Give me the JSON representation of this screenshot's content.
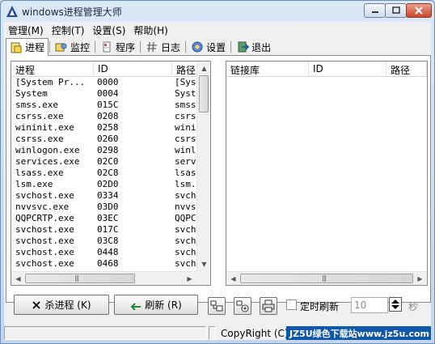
{
  "window": {
    "title": "windows进程管理大师"
  },
  "menu": [
    "管理(M)",
    "控制(T)",
    "设置(S)",
    "帮助(H)"
  ],
  "tabs": [
    {
      "label": "进程",
      "icon": "process-icon",
      "active": true
    },
    {
      "label": "监控",
      "icon": "monitor-icon",
      "active": false
    },
    {
      "label": "程序",
      "icon": "program-icon",
      "active": false
    },
    {
      "label": "日志",
      "icon": "log-icon",
      "active": false
    },
    {
      "label": "设置",
      "icon": "settings-icon",
      "active": false
    },
    {
      "label": "退出",
      "icon": "exit-icon",
      "active": false
    }
  ],
  "process_list": {
    "columns": [
      "进程",
      "ID",
      "路径"
    ],
    "rows": [
      [
        "[System Pr...",
        "0000",
        "[Sys"
      ],
      [
        "System",
        "0004",
        "Syst"
      ],
      [
        "smss.exe",
        "015C",
        "smss"
      ],
      [
        "csrss.exe",
        "0208",
        "csrs"
      ],
      [
        "wininit.exe",
        "0258",
        "wini"
      ],
      [
        "csrss.exe",
        "0260",
        "csrs"
      ],
      [
        "winlogon.exe",
        "0298",
        "winl"
      ],
      [
        "services.exe",
        "02C0",
        "serv"
      ],
      [
        "lsass.exe",
        "02C8",
        "lsas"
      ],
      [
        "lsm.exe",
        "02D0",
        "lsm."
      ],
      [
        "svchost.exe",
        "0334",
        "svch"
      ],
      [
        "nvvsvc.exe",
        "03D0",
        "nvvs"
      ],
      [
        "QQPCRTP.exe",
        "03EC",
        "QQPC"
      ],
      [
        "svchost.exe",
        "017C",
        "svch"
      ],
      [
        "svchost.exe",
        "03C8",
        "svch"
      ],
      [
        "svchost.exe",
        "0448",
        "svch"
      ],
      [
        "svchost.exe",
        "0468",
        "svch"
      ]
    ]
  },
  "library_list": {
    "columns": [
      "链接库",
      "ID",
      "路径"
    ],
    "rows": []
  },
  "buttons": {
    "kill": "杀进程 (K)",
    "refresh": "刷新 (R)"
  },
  "timer": {
    "checkbox_label": "定时刷新",
    "checked": false,
    "interval": "10",
    "unit": "秒"
  },
  "status": {
    "copyright": "CopyRight (C)",
    "watermark": "JZ5U绿色下载站www.jz5u.com"
  },
  "colors": {
    "titlebar": "#c3d6ec",
    "close_button": "#c9462c",
    "watermark_bg": "#0f57a8"
  }
}
